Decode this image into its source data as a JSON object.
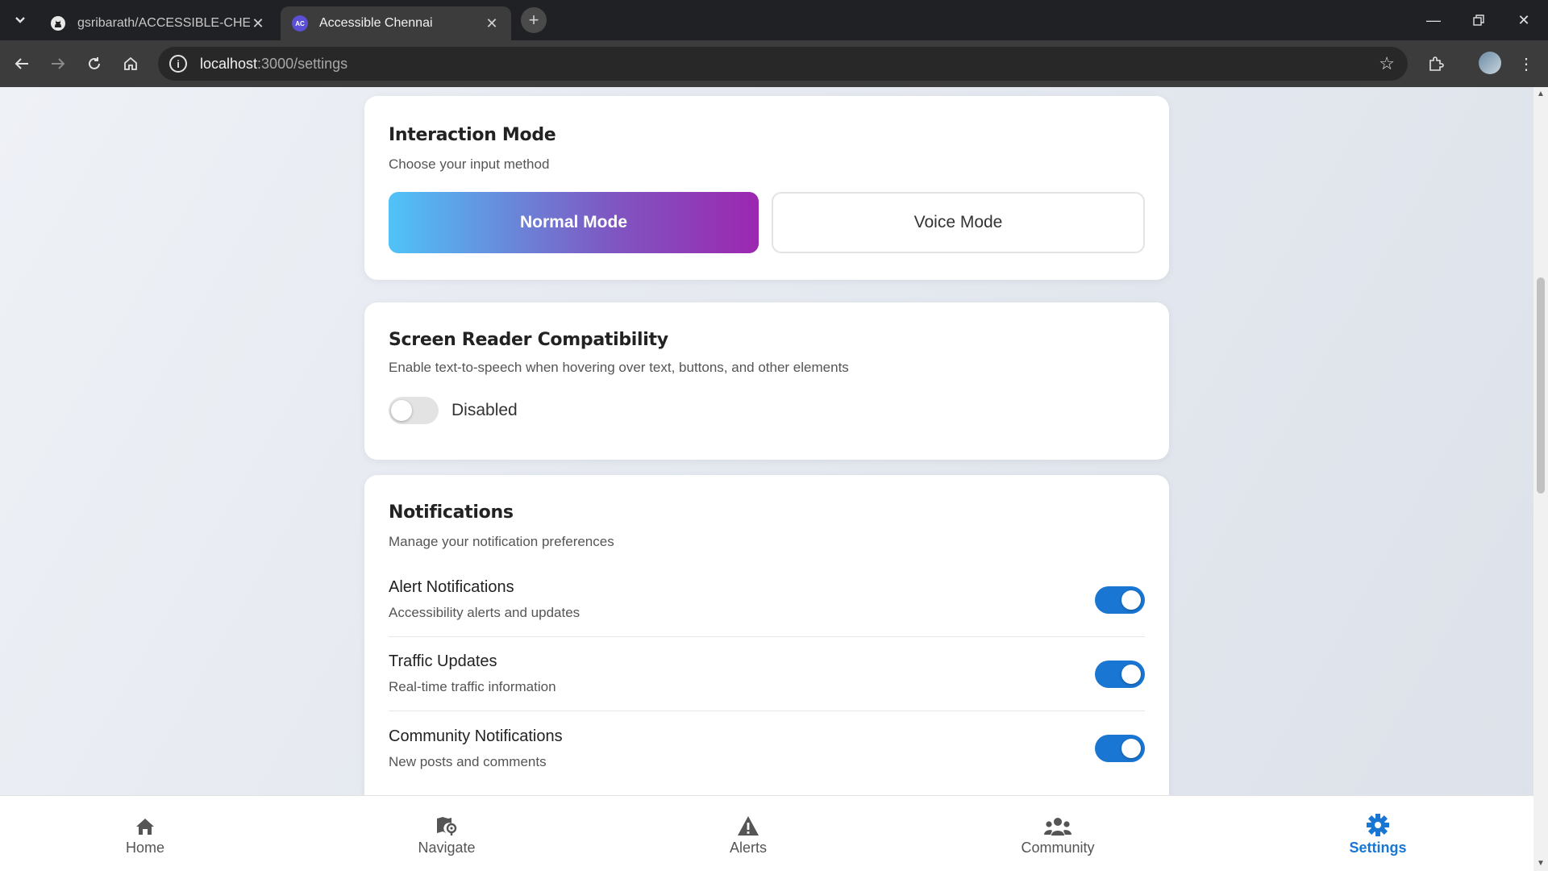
{
  "browser": {
    "tabs": [
      {
        "title": "gsribarath/ACCESSIBLE-CHENN",
        "icon": "github-icon"
      },
      {
        "title": "Accessible Chennai",
        "icon": "ac-favicon",
        "favicon_text": "AC"
      }
    ],
    "url_host": "localhost",
    "url_path": ":3000/settings"
  },
  "interaction_mode": {
    "title": "Interaction Mode",
    "subtitle": "Choose your input method",
    "normal_label": "Normal Mode",
    "voice_label": "Voice Mode",
    "selected": "Normal Mode"
  },
  "screen_reader": {
    "title": "Screen Reader Compatibility",
    "subtitle": "Enable text-to-speech when hovering over text, buttons, and other elements",
    "status_label": "Disabled",
    "enabled": false
  },
  "notifications": {
    "title": "Notifications",
    "subtitle": "Manage your notification preferences",
    "items": [
      {
        "title": "Alert Notifications",
        "desc": "Accessibility alerts and updates",
        "enabled": true
      },
      {
        "title": "Traffic Updates",
        "desc": "Real-time traffic information",
        "enabled": true
      },
      {
        "title": "Community Notifications",
        "desc": "New posts and comments",
        "enabled": true
      }
    ]
  },
  "bottom_nav": {
    "items": [
      {
        "label": "Home",
        "icon": "home-icon"
      },
      {
        "label": "Navigate",
        "icon": "map-icon"
      },
      {
        "label": "Alerts",
        "icon": "warning-icon"
      },
      {
        "label": "Community",
        "icon": "users-icon"
      },
      {
        "label": "Settings",
        "icon": "gear-icon"
      }
    ],
    "active": "Settings"
  },
  "colors": {
    "accent": "#1976d2",
    "toggle_off": "#e3e3e3",
    "gradient_start": "#4fc3f7",
    "gradient_end": "#9c27b0"
  }
}
